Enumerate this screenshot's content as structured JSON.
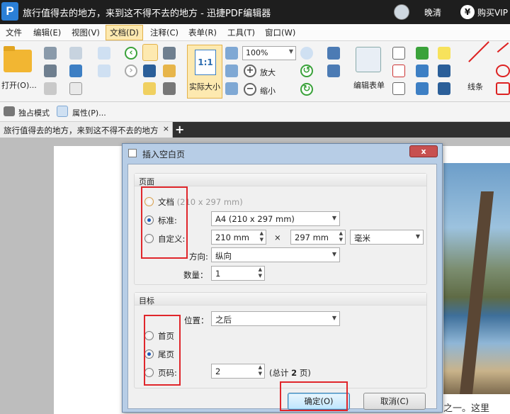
{
  "titlebar": {
    "title": "旅行值得去的地方，来到这不得不去的地方  -  迅捷PDF编辑器",
    "user": "晚清",
    "vip": "购买VIP",
    "vip_icon": "¥"
  },
  "menubar": [
    {
      "label": "文件"
    },
    {
      "label": "编辑(E)"
    },
    {
      "label": "视图(V)"
    },
    {
      "label": "文档(D)"
    },
    {
      "label": "注释(C)"
    },
    {
      "label": "表单(R)"
    },
    {
      "label": "工具(T)"
    },
    {
      "label": "窗口(W)"
    }
  ],
  "ribbon": {
    "open_label": "打开(O)...",
    "zoom_value": "100%",
    "actual_size_label": "实际大小",
    "actual_size_icon": "1:1",
    "zoom_in_label": "放大",
    "zoom_out_label": "缩小",
    "edit_form_label": "编辑表单",
    "line_label": "线条"
  },
  "toolbar2": {
    "exclusive_mode": "独占模式",
    "properties": "属性(P)..."
  },
  "tab": {
    "label": "旅行值得去的地方，来到这不得不去的地方",
    "close": "×",
    "add": "+"
  },
  "document": {
    "bottom_text": "之一。这里"
  },
  "dialog": {
    "title": "插入空白页",
    "close": "x",
    "page_group": {
      "heading": "页面",
      "opt_document": "文档",
      "opt_document_hint": "(210 x 297 mm)",
      "opt_standard": "标准:",
      "standard_value": "A4 (210 x 297 mm)",
      "opt_custom": "自定义:",
      "width_value": "210 mm",
      "times": "×",
      "height_value": "297 mm",
      "unit_value": "毫米",
      "orientation_label": "方向:",
      "orientation_value": "纵向",
      "count_label": "数量：",
      "count_value": "1"
    },
    "target_group": {
      "heading": "目标",
      "position_label": "位置：",
      "position_value": "之后",
      "opt_first": "首页",
      "opt_last": "尾页",
      "opt_page": "页码:",
      "page_value": "2",
      "total_prefix": "(总计 ",
      "total_num": "2",
      "total_suffix": " 页)"
    },
    "ok": "确定(O)",
    "cancel": "取消(C)"
  }
}
